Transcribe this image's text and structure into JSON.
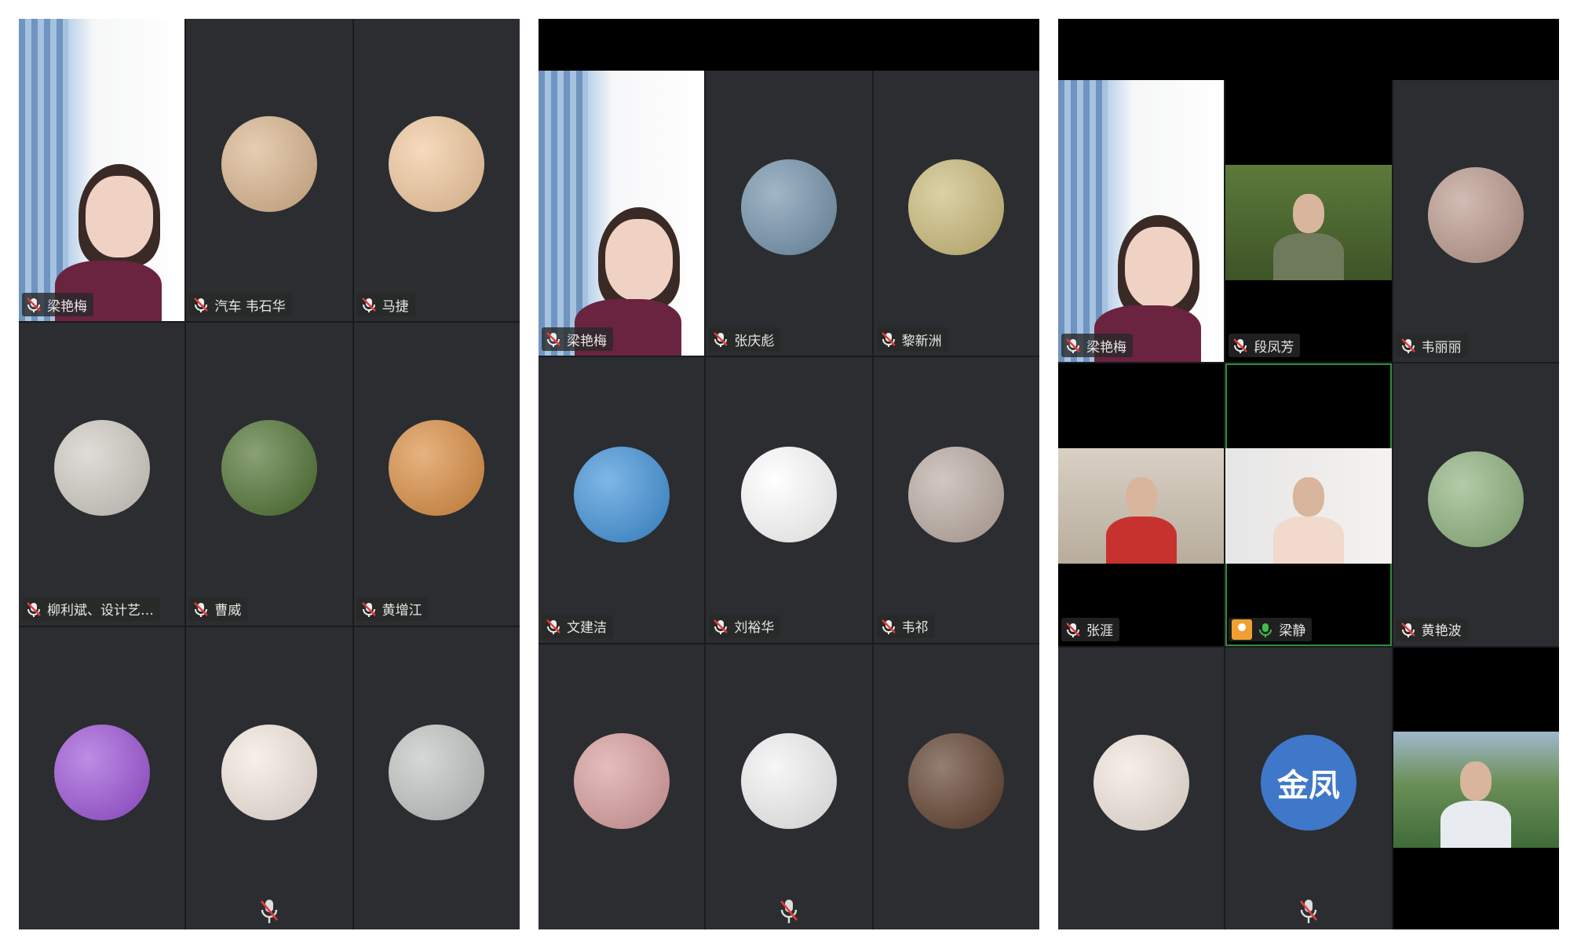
{
  "panels": [
    {
      "tiles": [
        {
          "name": "梁艳梅",
          "kind": "video"
        },
        {
          "name": "汽车 韦石华",
          "kind": "avatar",
          "avatar": "woman-photo",
          "bg": "#d9b38a"
        },
        {
          "name": "马捷",
          "kind": "avatar",
          "avatar": "cat-photo",
          "bg": "#f1c79a"
        },
        {
          "name": "柳利斌、设计艺…",
          "kind": "avatar",
          "avatar": "man-photo",
          "bg": "#cfcac2"
        },
        {
          "name": "曹威",
          "kind": "avatar",
          "avatar": "plant-photo",
          "bg": "#4a6e2c"
        },
        {
          "name": "黄增江",
          "kind": "avatar",
          "avatar": "sunset-photo",
          "bg": "#d98a3c"
        },
        {
          "name": "",
          "kind": "avatar",
          "avatar": "flowers-photo",
          "bg": "#9a4fd6"
        },
        {
          "name": "",
          "kind": "avatar",
          "avatar": "baby-photo",
          "bg": "#f3e7de"
        },
        {
          "name": "",
          "kind": "avatar",
          "avatar": "frost-photo",
          "bg": "#bfc3c0"
        }
      ]
    },
    {
      "tiles": [
        {
          "name": "梁艳梅",
          "kind": "video"
        },
        {
          "name": "张庆彪",
          "kind": "avatar",
          "avatar": "mountain-photo",
          "bg": "#6f8fa8"
        },
        {
          "name": "黎新洲",
          "kind": "avatar",
          "avatar": "field-photo",
          "bg": "#c9b976"
        },
        {
          "name": "文建洁",
          "kind": "avatar",
          "avatar": "doraemon-icon",
          "bg": "#3a8fd8"
        },
        {
          "name": "刘裕华",
          "kind": "avatar",
          "avatar": "blank-avatar",
          "bg": "#ffffff"
        },
        {
          "name": "韦祁",
          "kind": "avatar",
          "avatar": "street-photo",
          "bg": "#b9a9a0"
        },
        {
          "name": "",
          "kind": "avatar",
          "avatar": "cartoon-girl",
          "bg": "#d79a9a"
        },
        {
          "name": "",
          "kind": "avatar",
          "avatar": "sketch-figure",
          "bg": "#f2f2f2"
        },
        {
          "name": "",
          "kind": "avatar",
          "avatar": "bear-photo",
          "bg": "#5a3a26"
        }
      ]
    },
    {
      "tiles": [
        {
          "name": "梁艳梅",
          "kind": "video"
        },
        {
          "name": "段凤芳",
          "kind": "camera",
          "cam": "green"
        },
        {
          "name": "韦丽丽",
          "kind": "avatar",
          "avatar": "hand-photo",
          "bg": "#b9978a"
        },
        {
          "name": "张涯",
          "kind": "camera",
          "cam": "office"
        },
        {
          "name": "梁静",
          "kind": "camera",
          "cam": "bright",
          "host": true,
          "active": true
        },
        {
          "name": "黄艳波",
          "kind": "avatar",
          "avatar": "garden-photo",
          "bg": "#8bb07a"
        },
        {
          "name": "",
          "kind": "avatar",
          "avatar": "hourglass-icon",
          "bg": "#f1e6dc"
        },
        {
          "name": "",
          "kind": "avatar",
          "avatar": "text-avatar",
          "text": "金凤",
          "bg": "#3f77c9"
        },
        {
          "name": "",
          "kind": "camera",
          "cam": "land"
        }
      ]
    }
  ]
}
